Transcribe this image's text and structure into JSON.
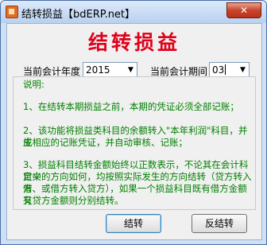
{
  "window": {
    "title": "结转损益【bdERP.net】",
    "close_label": "✕"
  },
  "main": {
    "heading": "结转损益",
    "year_label": "当前会计年度",
    "year_value": "2015",
    "period_label": "当前会计期间",
    "period_value": "03",
    "notes_title": "说明:",
    "note_1": "1、在结转本期损益之前，本期的凭证必须全部记账；",
    "note_2_line1": "2、该功能将损益类科目的余额转入\"本年利润\"科目，并生",
    "note_2_line2": "成相应的记账凭证，并自动审核、记账；",
    "note_3_line1": "3、损益科目结转金额始终以正数表示，不论其在会计科目中",
    "note_3_line2": "定义的方向如何，均按照实际发生的方向结转（贷方转入借",
    "note_3_line3": "方、或借方转入贷方），如果一个损益科目既有借方金额又",
    "note_3_line4": "有贷方金额则分别结转。"
  },
  "buttons": {
    "carry_forward": "结转",
    "reverse_carry_forward": "反结转"
  },
  "colors": {
    "heading": "#e0001a",
    "notes": "#008000"
  },
  "icons": {
    "app": "app-icon",
    "dropdown": "chevron-down-icon",
    "close": "close-icon"
  }
}
